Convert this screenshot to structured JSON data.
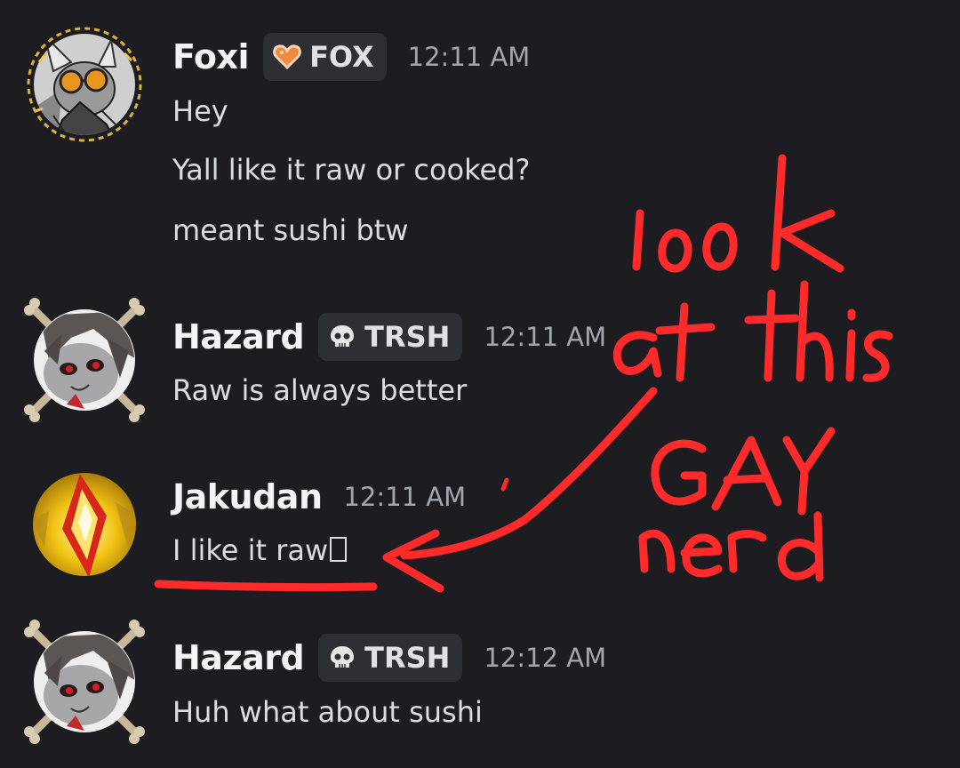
{
  "messages": [
    {
      "username": "Foxi",
      "tag": {
        "label": "FOX",
        "icon": "orange-heart-icon"
      },
      "timestamp": "12:11 AM",
      "lines": [
        "Hey",
        "Yall like it raw or cooked?",
        "meant sushi btw"
      ]
    },
    {
      "username": "Hazard",
      "tag": {
        "label": "TRSH",
        "icon": "skull-icon"
      },
      "timestamp": "12:11 AM",
      "lines": [
        "Raw is always better"
      ]
    },
    {
      "username": "Jakudan",
      "timestamp": "12:11 AM",
      "lines": [
        "I like it raw"
      ]
    },
    {
      "username": "Hazard",
      "tag": {
        "label": "TRSH",
        "icon": "skull-icon"
      },
      "timestamp": "12:12 AM",
      "lines": [
        "Huh what about sushi"
      ]
    }
  ],
  "annotation": {
    "text_lines": [
      "look",
      "at this",
      "GAY",
      "nerd"
    ],
    "color": "#ff2a2a"
  },
  "colors": {
    "background": "#1c1c21",
    "username": "#f2f3f5",
    "message_text": "#dbdee1",
    "timestamp": "#a2a6ad",
    "tag_background": "#2e2f35"
  }
}
